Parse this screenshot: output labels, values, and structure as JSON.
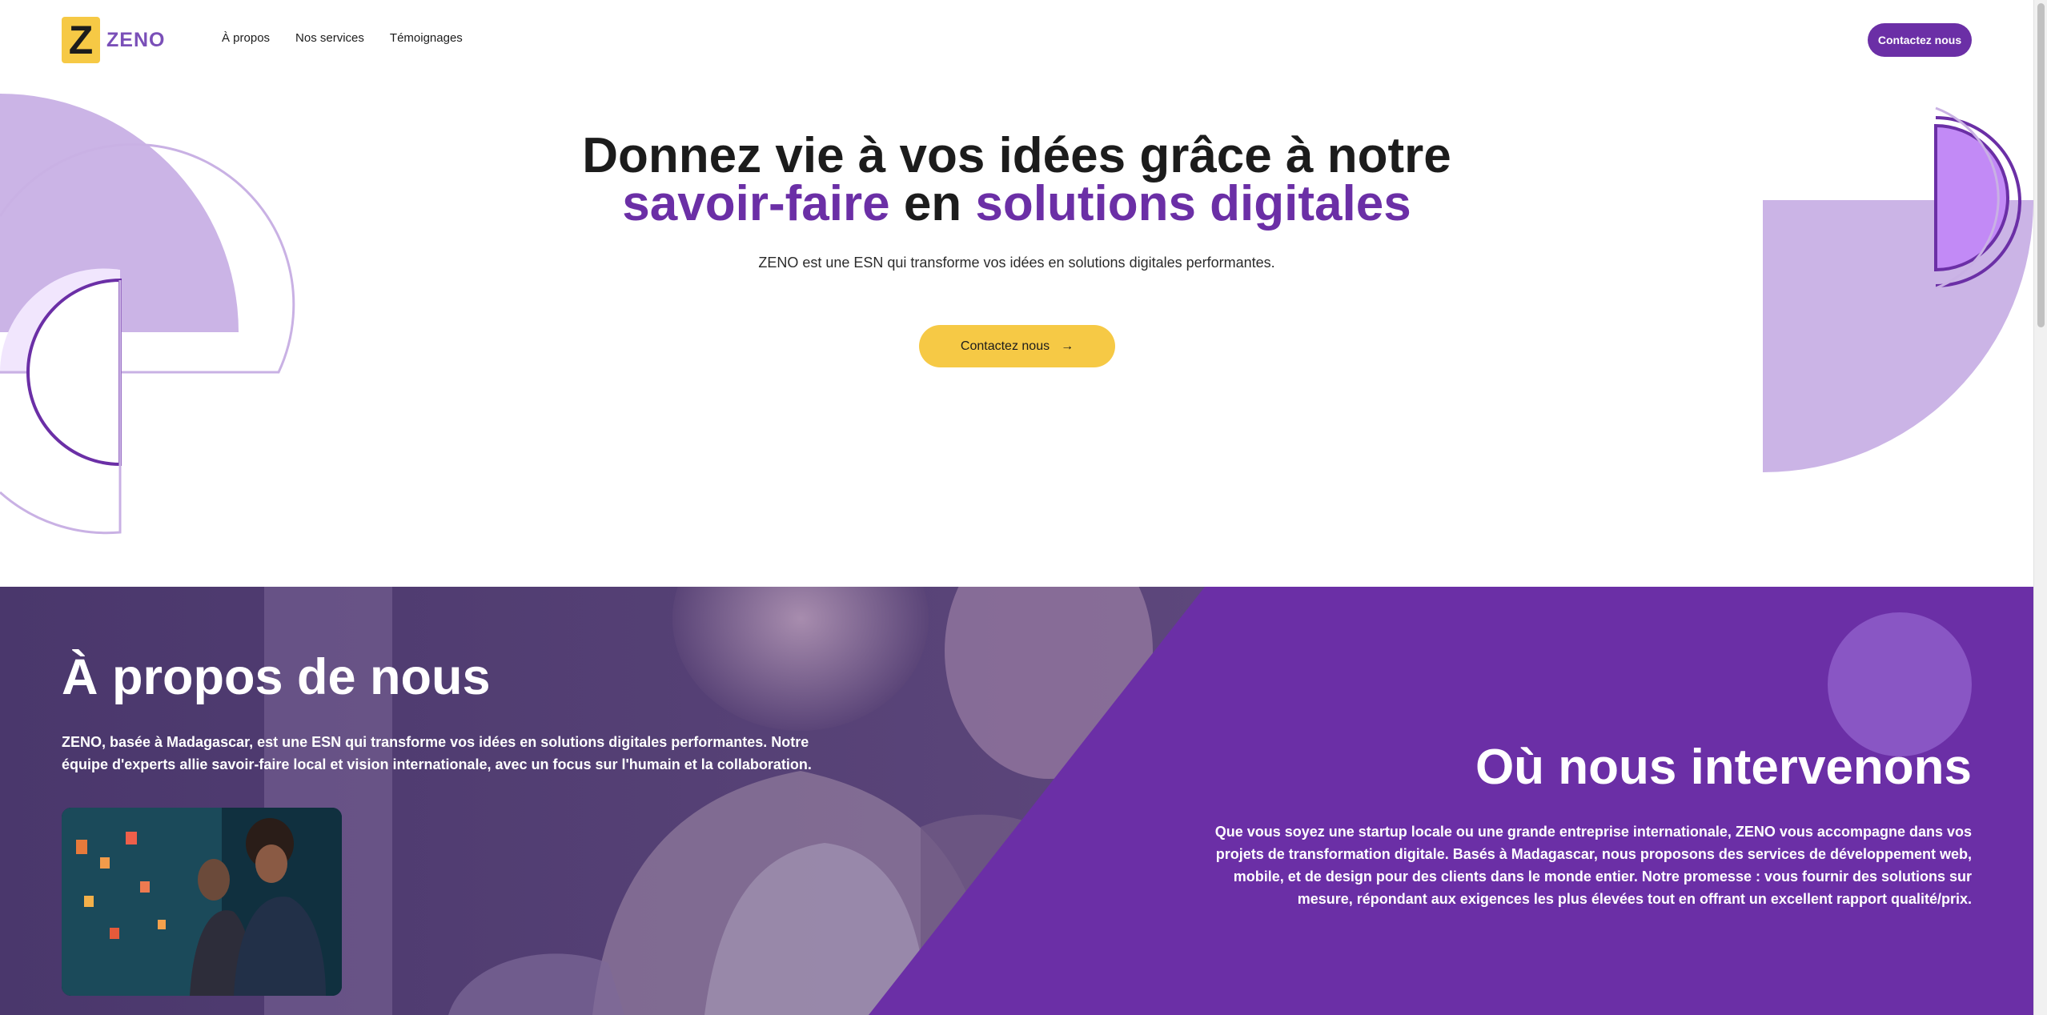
{
  "nav": {
    "logo_letter": "Z",
    "logo_word": "ZENO",
    "links": [
      "À propos",
      "Nos services",
      "Témoignages"
    ],
    "cta": "Contactez nous"
  },
  "hero": {
    "title_line1": "Donnez vie à vos idées grâce à notre",
    "title_accent1": "savoir-faire",
    "title_mid": "en",
    "title_accent2": "solutions digitales",
    "subtitle": "ZENO est une ESN qui transforme vos idées en solutions digitales performantes.",
    "cta": "Contactez nous",
    "cta_icon": "arrow-right-icon"
  },
  "about": {
    "title": "À propos de nous",
    "text": "ZENO, basée à Madagascar, est une ESN qui transforme vos idées en solutions digitales performantes. Notre équipe d'experts allie savoir-faire local et vision internationale, avec un focus sur l'humain et la collaboration."
  },
  "where": {
    "title": "Où nous intervenons",
    "text": "Que vous soyez une startup locale ou une grande entreprise internationale, ZENO vous accompagne dans vos projets de transformation digitale. Basés à Madagascar, nous proposons des services de développement web, mobile, et de design pour des clients dans le monde entier. Notre promesse : vous fournir des solutions sur mesure, répondant aux exigences les plus élevées tout en offrant un excellent rapport qualité/prix."
  },
  "colors": {
    "brand_purple": "#6b2fa6",
    "brand_yellow": "#f6c945",
    "light_purple": "#cbb4e6"
  }
}
